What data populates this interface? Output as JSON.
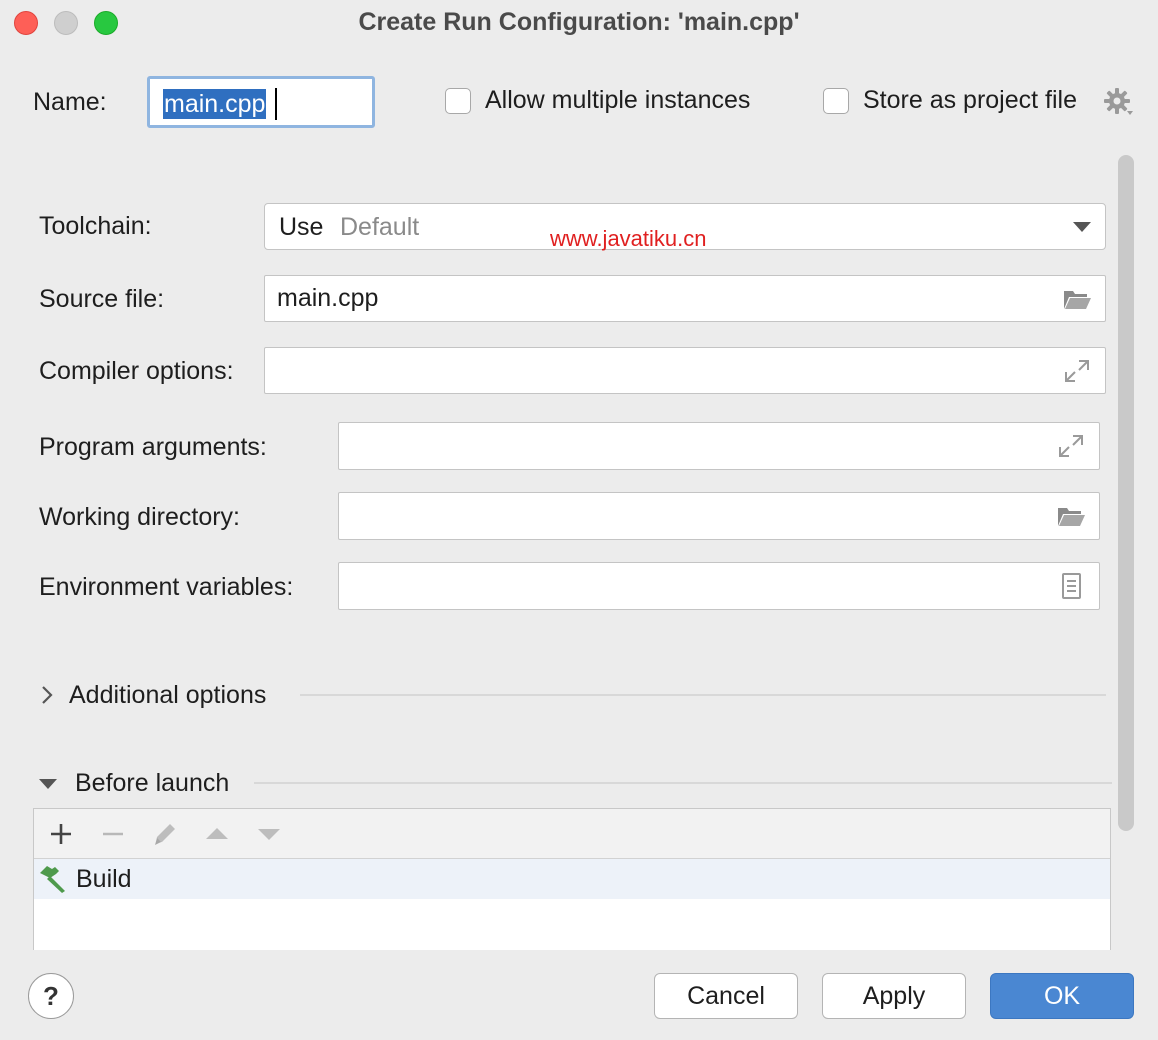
{
  "window": {
    "title": "Create Run Configuration: 'main.cpp'"
  },
  "header": {
    "name_label": "Name:",
    "name_value": "main.cpp",
    "allow_multiple_label": "Allow multiple instances",
    "allow_multiple_checked": false,
    "store_project_label": "Store as project file",
    "store_project_checked": false,
    "settings_icon": "gear-icon"
  },
  "form": {
    "toolchain_label": "Toolchain:",
    "toolchain_prefix": "Use",
    "toolchain_value": "Default",
    "source_file_label": "Source file:",
    "source_file_value": "main.cpp",
    "compiler_options_label": "Compiler options:",
    "compiler_options_value": "",
    "program_arguments_label": "Program arguments:",
    "program_arguments_value": "",
    "working_directory_label": "Working directory:",
    "working_directory_value": "",
    "environment_variables_label": "Environment variables:",
    "environment_variables_value": ""
  },
  "watermark": "www.javatiku.cn",
  "sections": {
    "additional_options": "Additional options",
    "additional_options_expanded": false,
    "before_launch": "Before launch",
    "before_launch_expanded": true
  },
  "before_launch": {
    "toolbar_icons": [
      "plus-icon",
      "minus-icon",
      "pencil-icon",
      "arrow-up-icon",
      "arrow-down-icon"
    ],
    "tasks": [
      {
        "icon": "hammer-icon",
        "label": "Build"
      }
    ]
  },
  "footer": {
    "help_label": "?",
    "cancel_label": "Cancel",
    "apply_label": "Apply",
    "ok_label": "OK"
  },
  "colors": {
    "accent": "#4a87d2",
    "selection": "#2f6fc0",
    "build_icon": "#4e9a4c",
    "watermark": "#e02020"
  }
}
